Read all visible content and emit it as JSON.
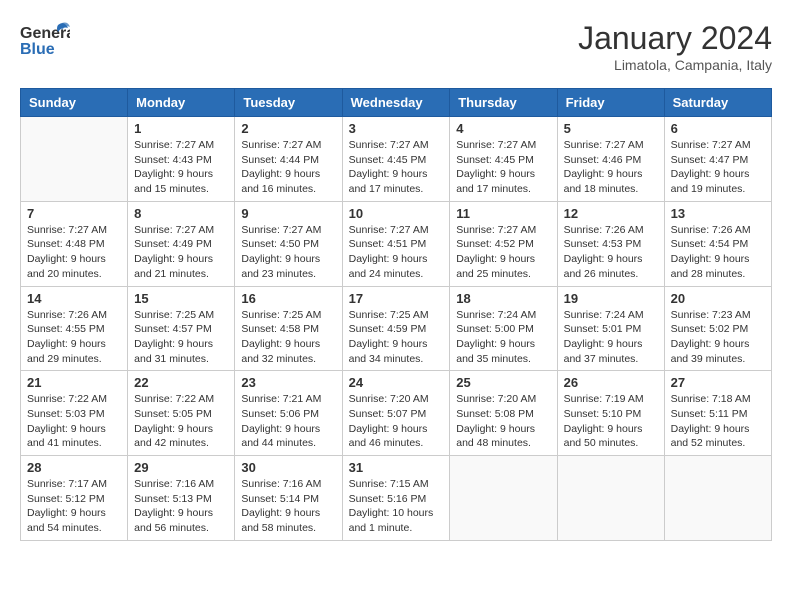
{
  "logo": {
    "general": "General",
    "blue": "Blue"
  },
  "header": {
    "month": "January 2024",
    "location": "Limatola, Campania, Italy"
  },
  "weekdays": [
    "Sunday",
    "Monday",
    "Tuesday",
    "Wednesday",
    "Thursday",
    "Friday",
    "Saturday"
  ],
  "weeks": [
    [
      {
        "day": "",
        "info": ""
      },
      {
        "day": "1",
        "info": "Sunrise: 7:27 AM\nSunset: 4:43 PM\nDaylight: 9 hours\nand 15 minutes."
      },
      {
        "day": "2",
        "info": "Sunrise: 7:27 AM\nSunset: 4:44 PM\nDaylight: 9 hours\nand 16 minutes."
      },
      {
        "day": "3",
        "info": "Sunrise: 7:27 AM\nSunset: 4:45 PM\nDaylight: 9 hours\nand 17 minutes."
      },
      {
        "day": "4",
        "info": "Sunrise: 7:27 AM\nSunset: 4:45 PM\nDaylight: 9 hours\nand 17 minutes."
      },
      {
        "day": "5",
        "info": "Sunrise: 7:27 AM\nSunset: 4:46 PM\nDaylight: 9 hours\nand 18 minutes."
      },
      {
        "day": "6",
        "info": "Sunrise: 7:27 AM\nSunset: 4:47 PM\nDaylight: 9 hours\nand 19 minutes."
      }
    ],
    [
      {
        "day": "7",
        "info": ""
      },
      {
        "day": "8",
        "info": "Sunrise: 7:27 AM\nSunset: 4:49 PM\nDaylight: 9 hours\nand 21 minutes."
      },
      {
        "day": "9",
        "info": "Sunrise: 7:27 AM\nSunset: 4:50 PM\nDaylight: 9 hours\nand 23 minutes."
      },
      {
        "day": "10",
        "info": "Sunrise: 7:27 AM\nSunset: 4:51 PM\nDaylight: 9 hours\nand 24 minutes."
      },
      {
        "day": "11",
        "info": "Sunrise: 7:27 AM\nSunset: 4:52 PM\nDaylight: 9 hours\nand 25 minutes."
      },
      {
        "day": "12",
        "info": "Sunrise: 7:26 AM\nSunset: 4:53 PM\nDaylight: 9 hours\nand 26 minutes."
      },
      {
        "day": "13",
        "info": "Sunrise: 7:26 AM\nSunset: 4:54 PM\nDaylight: 9 hours\nand 28 minutes."
      }
    ],
    [
      {
        "day": "14",
        "info": ""
      },
      {
        "day": "15",
        "info": "Sunrise: 7:25 AM\nSunset: 4:57 PM\nDaylight: 9 hours\nand 31 minutes."
      },
      {
        "day": "16",
        "info": "Sunrise: 7:25 AM\nSunset: 4:58 PM\nDaylight: 9 hours\nand 32 minutes."
      },
      {
        "day": "17",
        "info": "Sunrise: 7:25 AM\nSunset: 4:59 PM\nDaylight: 9 hours\nand 34 minutes."
      },
      {
        "day": "18",
        "info": "Sunrise: 7:24 AM\nSunset: 5:00 PM\nDaylight: 9 hours\nand 35 minutes."
      },
      {
        "day": "19",
        "info": "Sunrise: 7:24 AM\nSunset: 5:01 PM\nDaylight: 9 hours\nand 37 minutes."
      },
      {
        "day": "20",
        "info": "Sunrise: 7:23 AM\nSunset: 5:02 PM\nDaylight: 9 hours\nand 39 minutes."
      }
    ],
    [
      {
        "day": "21",
        "info": "Sunrise: 7:22 AM\nSunset: 5:03 PM\nDaylight: 9 hours\nand 41 minutes."
      },
      {
        "day": "22",
        "info": "Sunrise: 7:22 AM\nSunset: 5:05 PM\nDaylight: 9 hours\nand 42 minutes."
      },
      {
        "day": "23",
        "info": "Sunrise: 7:21 AM\nSunset: 5:06 PM\nDaylight: 9 hours\nand 44 minutes."
      },
      {
        "day": "24",
        "info": "Sunrise: 7:20 AM\nSunset: 5:07 PM\nDaylight: 9 hours\nand 46 minutes."
      },
      {
        "day": "25",
        "info": "Sunrise: 7:20 AM\nSunset: 5:08 PM\nDaylight: 9 hours\nand 48 minutes."
      },
      {
        "day": "26",
        "info": "Sunrise: 7:19 AM\nSunset: 5:10 PM\nDaylight: 9 hours\nand 50 minutes."
      },
      {
        "day": "27",
        "info": "Sunrise: 7:18 AM\nSunset: 5:11 PM\nDaylight: 9 hours\nand 52 minutes."
      }
    ],
    [
      {
        "day": "28",
        "info": "Sunrise: 7:17 AM\nSunset: 5:12 PM\nDaylight: 9 hours\nand 54 minutes."
      },
      {
        "day": "29",
        "info": "Sunrise: 7:16 AM\nSunset: 5:13 PM\nDaylight: 9 hours\nand 56 minutes."
      },
      {
        "day": "30",
        "info": "Sunrise: 7:16 AM\nSunset: 5:14 PM\nDaylight: 9 hours\nand 58 minutes."
      },
      {
        "day": "31",
        "info": "Sunrise: 7:15 AM\nSunset: 5:16 PM\nDaylight: 10 hours\nand 1 minute."
      },
      {
        "day": "",
        "info": ""
      },
      {
        "day": "",
        "info": ""
      },
      {
        "day": "",
        "info": ""
      }
    ]
  ],
  "week1_sunday": "Sunrise: 7:27 AM\nSunset: 4:48 PM\nDaylight: 9 hours\nand 20 minutes.",
  "week3_sunday": "Sunrise: 7:26 AM\nSunset: 4:55 PM\nDaylight: 9 hours\nand 29 minutes."
}
